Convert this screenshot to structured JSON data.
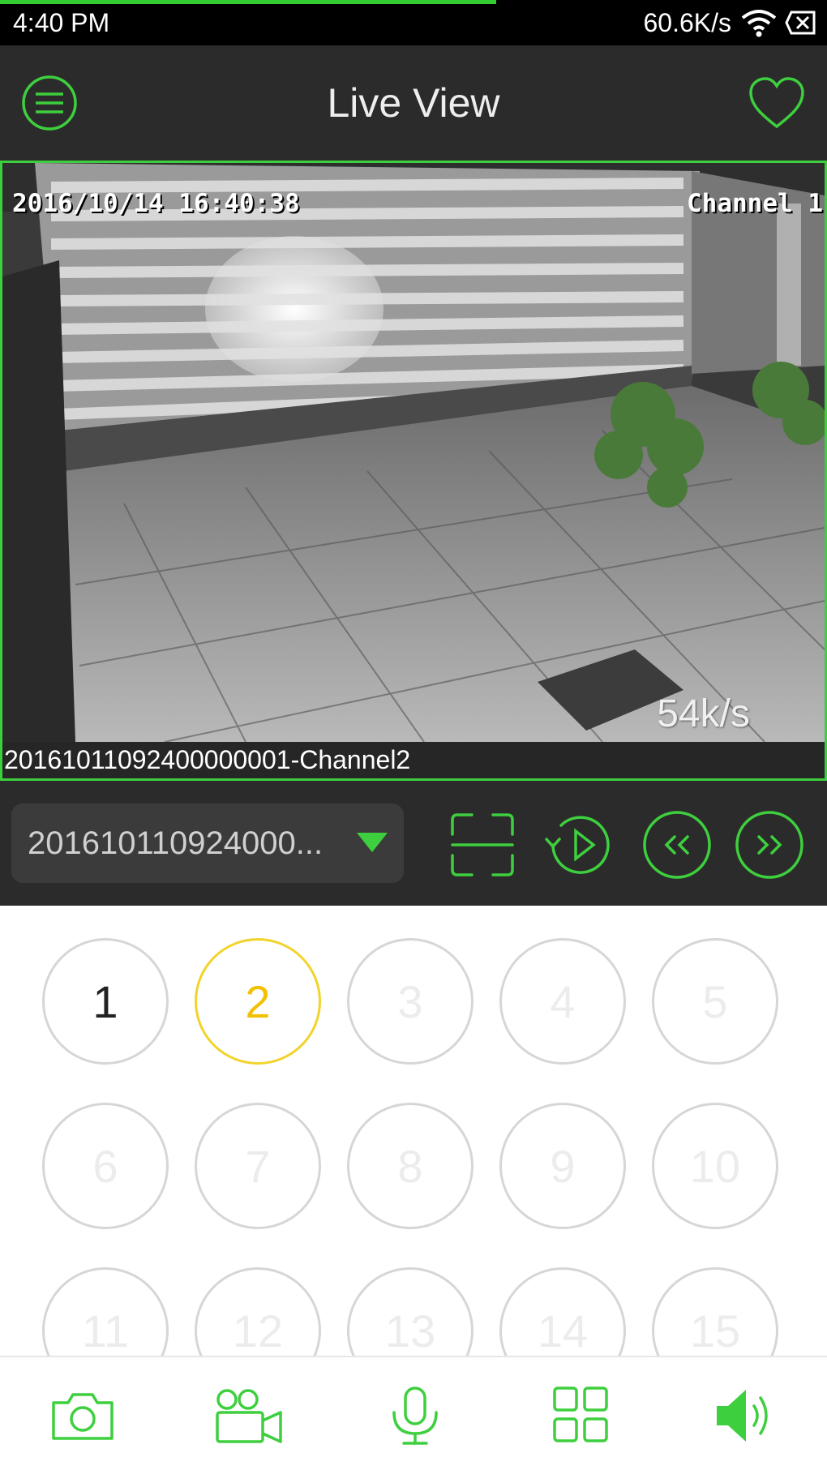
{
  "status_bar": {
    "time": "4:40 PM",
    "net_speed": "60.6K/s",
    "load_progress": 0.6
  },
  "header": {
    "title": "Live View",
    "menu_icon": "menu-icon",
    "favorite_icon": "heart-icon"
  },
  "video": {
    "osd_timestamp": "2016/10/14 16:40:38",
    "osd_channel": "Channel 1",
    "bitrate": "54k/s",
    "caption": "20161011092400000001-Channel2"
  },
  "controls": {
    "device_selected": "201610110924000...",
    "buttons": [
      "fullscreen-icon",
      "playback-icon",
      "previous-icon",
      "next-icon"
    ]
  },
  "channels": {
    "labels": [
      "1",
      "2",
      "3",
      "4",
      "5",
      "6",
      "7",
      "8",
      "9",
      "10",
      "11",
      "12",
      "13",
      "14",
      "15"
    ],
    "active": [
      1,
      2
    ],
    "selected": 2
  },
  "bottom_bar": {
    "buttons": [
      "camera-icon",
      "record-icon",
      "microphone-icon",
      "grid-icon",
      "speaker-icon"
    ]
  },
  "colors": {
    "accent_green": "#3ecf3e",
    "selected_yellow": "#f2c200",
    "dark_bar": "#2b2b2b"
  }
}
